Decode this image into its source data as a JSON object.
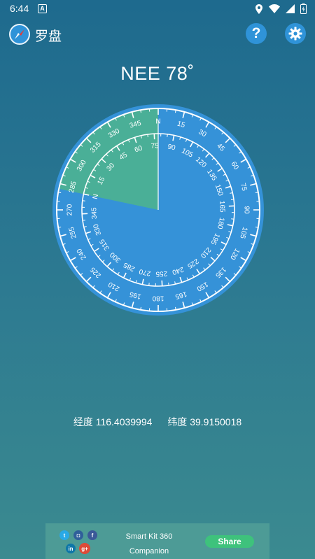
{
  "status_bar": {
    "time": "6:44",
    "notification_badge": "A"
  },
  "app_bar": {
    "title": "罗盘"
  },
  "heading": "NEE 78˚",
  "compass": {
    "heading_degrees": 78,
    "sector_degrees": 78,
    "outer_ring_rotation_degrees": 0,
    "inner_ring_rotation_degrees": -78,
    "cardinal_label": "N",
    "outer_labels": [
      "N",
      "15",
      "30",
      "45",
      "60",
      "75",
      "90",
      "105",
      "120",
      "135",
      "150",
      "165",
      "180",
      "195",
      "210",
      "225",
      "240",
      "255",
      "270",
      "285",
      "300",
      "315",
      "330",
      "345"
    ],
    "inner_labels": [
      "N",
      "15",
      "30",
      "45",
      "60",
      "75",
      "90",
      "105",
      "120",
      "135",
      "150",
      "165",
      "180",
      "195",
      "210",
      "225",
      "240",
      "255",
      "270",
      "285",
      "300",
      "315",
      "330",
      "345"
    ],
    "colors": {
      "dial": "#3592d8",
      "sector": "#4aaf97",
      "ring": "#ffffff"
    }
  },
  "location": {
    "longitude_label": "经度",
    "longitude_value": "116.4039994",
    "latitude_label": "纬度",
    "latitude_value": "39.9150018"
  },
  "ad": {
    "line1": "Smart Kit 360",
    "line2": "Companion",
    "share_label": "Share",
    "social_icons": [
      "twitter-icon",
      "instagram-icon",
      "facebook-icon",
      "linkedin-icon",
      "google-plus-icon"
    ]
  }
}
